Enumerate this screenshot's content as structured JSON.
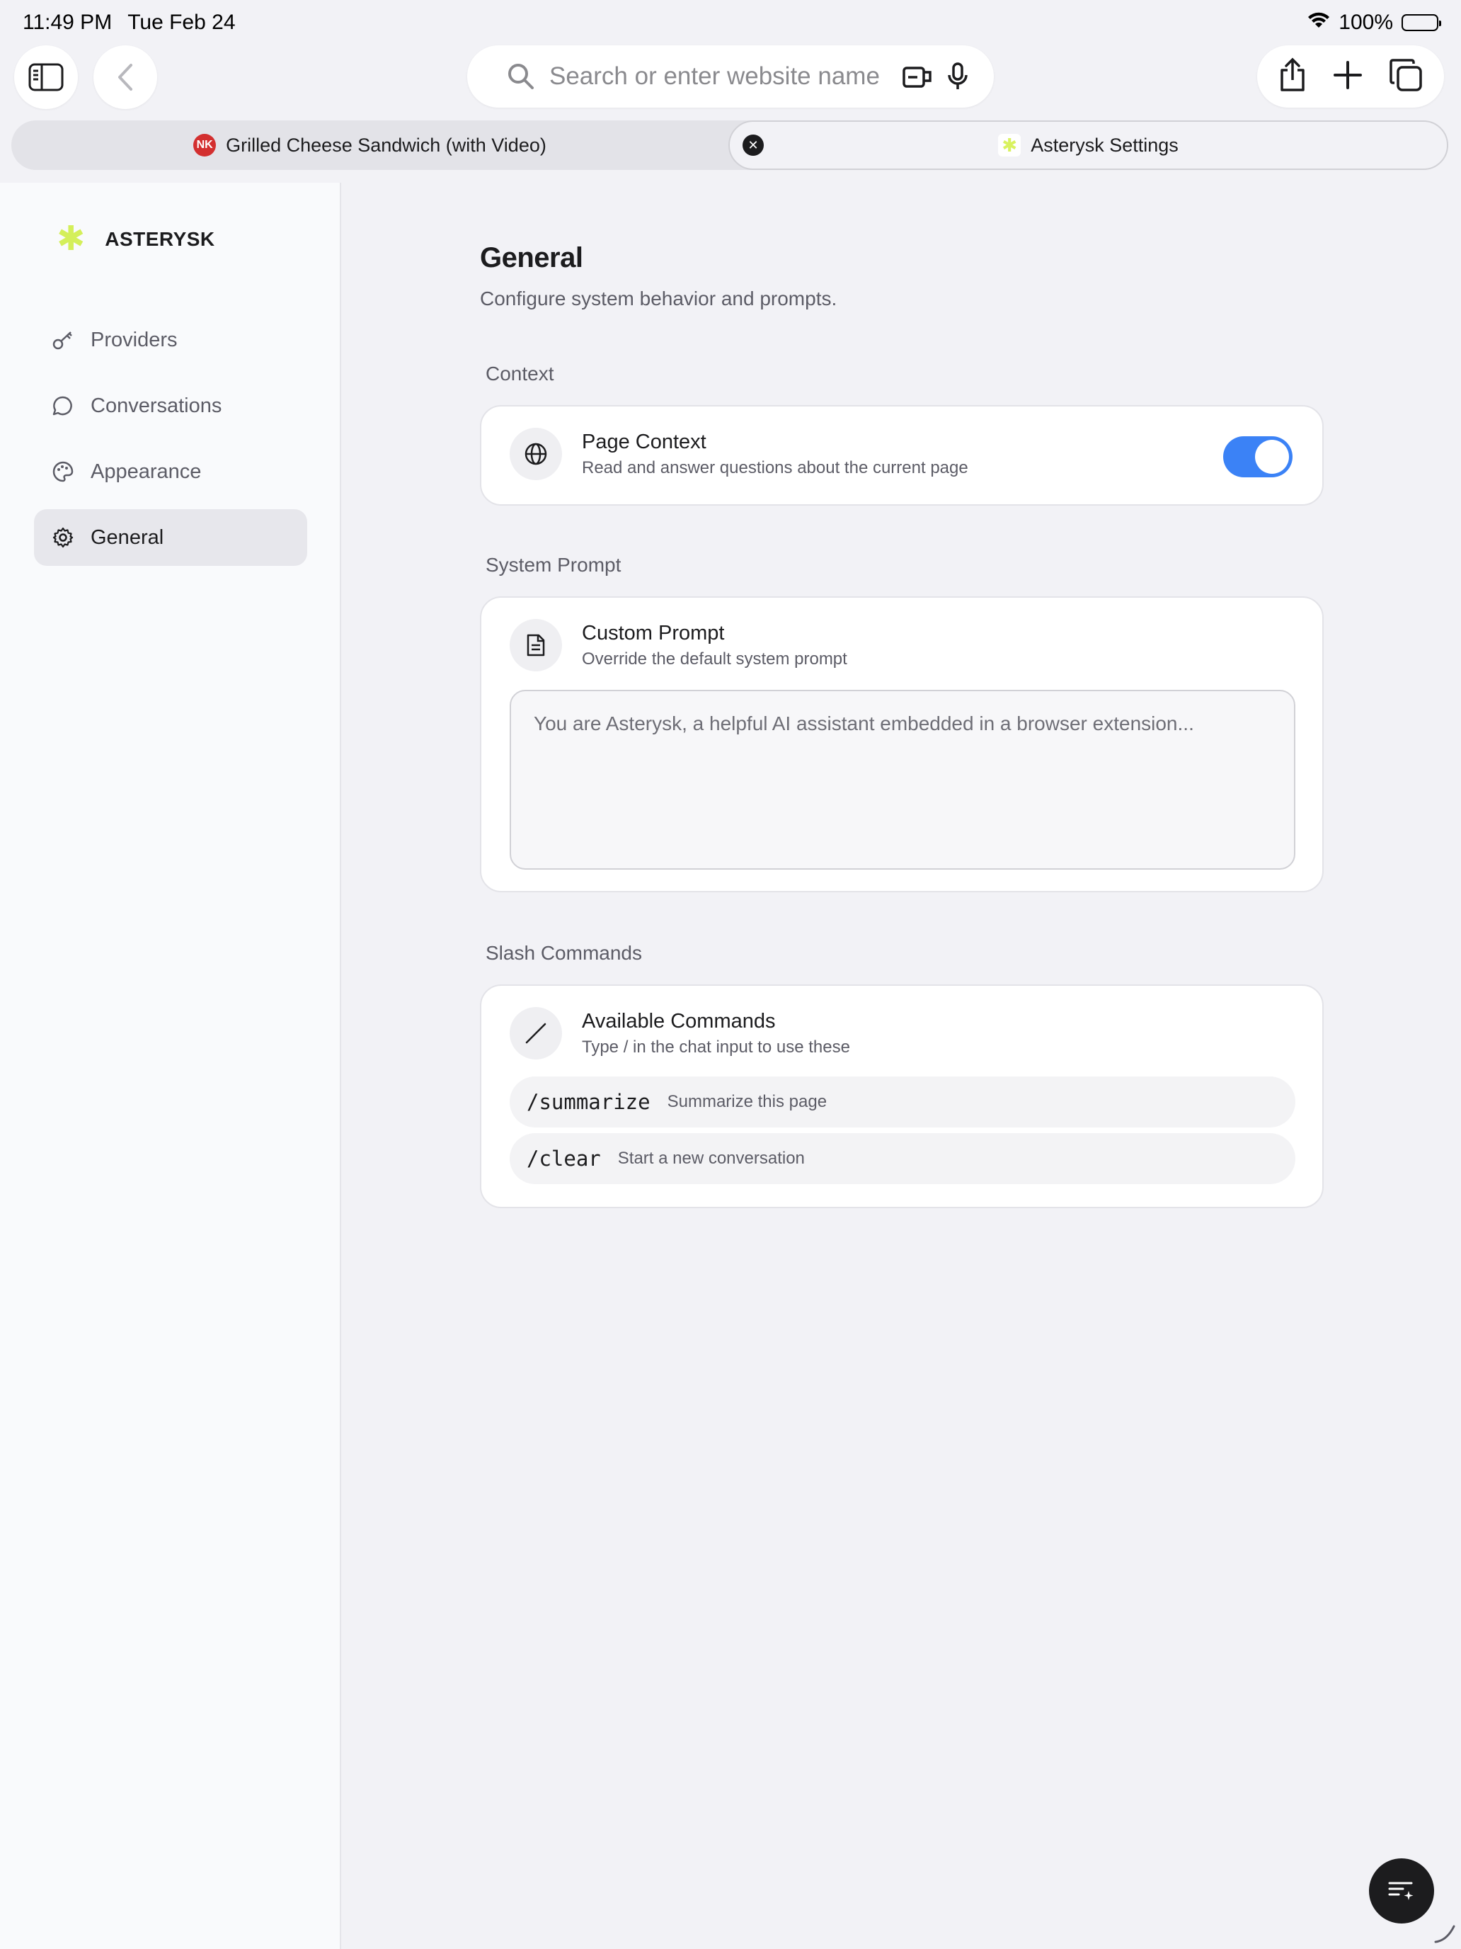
{
  "status_bar": {
    "time": "11:49 PM",
    "date": "Tue Feb 24",
    "battery": "100%"
  },
  "toolbar": {
    "search_placeholder": "Search or enter website name"
  },
  "tabs": [
    {
      "favicon": "NK",
      "label": "Grilled Cheese Sandwich (with Video)",
      "active": false
    },
    {
      "favicon": "✱",
      "label": "Asterysk Settings",
      "active": true
    }
  ],
  "sidebar": {
    "brand": "ASTERYSK",
    "items": [
      {
        "label": "Providers",
        "icon": "key-icon"
      },
      {
        "label": "Conversations",
        "icon": "chat-bubble-icon"
      },
      {
        "label": "Appearance",
        "icon": "palette-icon"
      },
      {
        "label": "General",
        "icon": "gear-icon",
        "active": true
      }
    ]
  },
  "main": {
    "title": "General",
    "subtitle": "Configure system behavior and prompts.",
    "sections": {
      "context": {
        "label": "Context",
        "title": "Page Context",
        "desc": "Read and answer questions about the current page",
        "enabled": true
      },
      "system_prompt": {
        "label": "System Prompt",
        "title": "Custom Prompt",
        "desc": "Override the default system prompt",
        "placeholder": "You are Asterysk, a helpful AI assistant embedded in a browser extension..."
      },
      "slash_commands": {
        "label": "Slash Commands",
        "title": "Available Commands",
        "desc": "Type / in the chat input to use these",
        "commands": [
          {
            "name": "/summarize",
            "desc": "Summarize this page"
          },
          {
            "name": "/clear",
            "desc": "Start a new conversation"
          }
        ]
      }
    }
  },
  "colors": {
    "accent": "#3b82f6",
    "brand": "#d4ef5a"
  }
}
